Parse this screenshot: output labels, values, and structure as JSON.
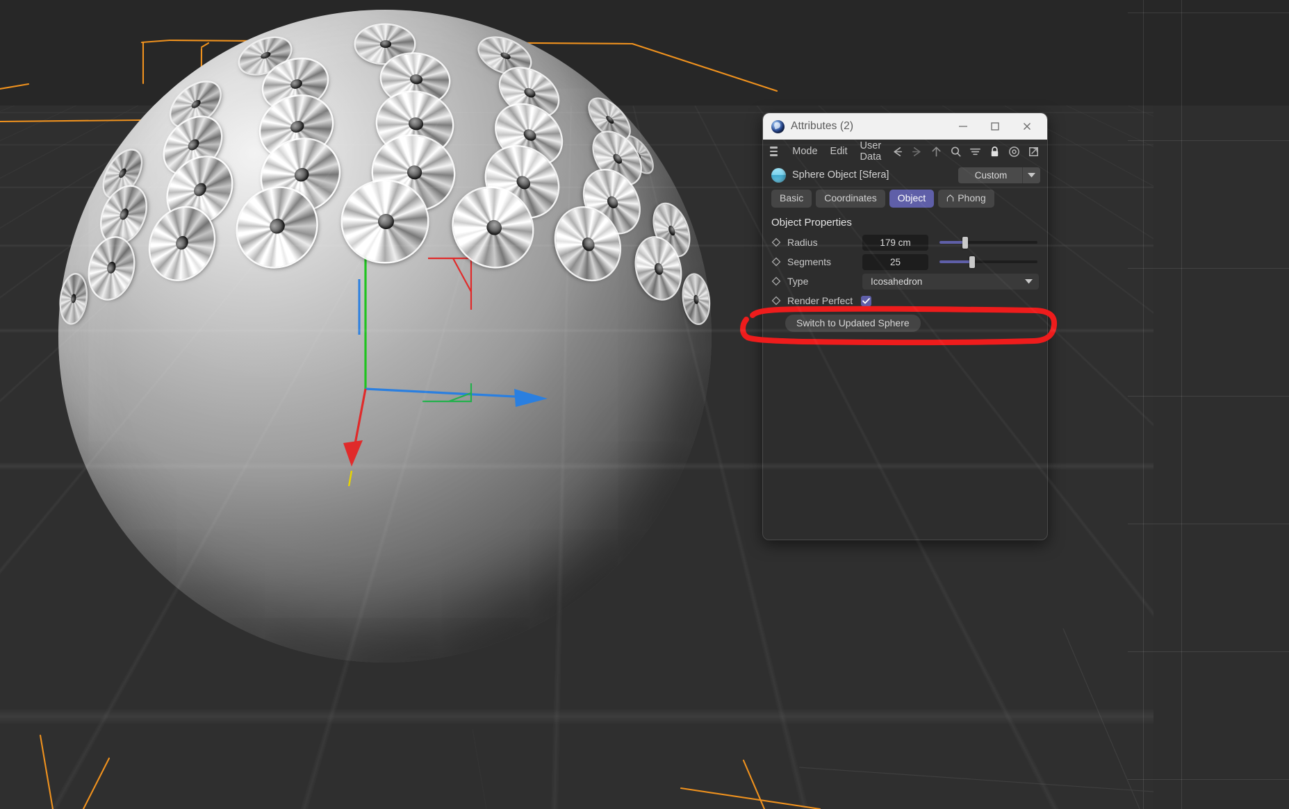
{
  "app": {
    "window_title": "Attributes (2)",
    "logo_icon": "cinema4d-logo-icon"
  },
  "titlebar_buttons": [
    {
      "name": "minimize-button",
      "icon": "minimize-icon"
    },
    {
      "name": "maximize-button",
      "icon": "maximize-icon"
    },
    {
      "name": "close-button",
      "icon": "close-icon"
    }
  ],
  "toolbar": {
    "menu_icon": "hamburger-menu-icon",
    "menus": [
      {
        "label": "Mode"
      },
      {
        "label": "Edit"
      },
      {
        "label": "User Data"
      }
    ],
    "icons": [
      {
        "name": "back-arrow-icon"
      },
      {
        "name": "forward-arrow-icon"
      },
      {
        "name": "up-arrow-icon"
      },
      {
        "name": "search-icon"
      },
      {
        "name": "filter-icon"
      },
      {
        "name": "lock-icon"
      },
      {
        "name": "target-icon"
      },
      {
        "name": "open-external-icon"
      }
    ]
  },
  "object_header": {
    "icon": "sphere-object-icon",
    "name": "Sphere Object [Sfera]",
    "preset_value": "Custom",
    "preset_arrow_icon": "chevron-down-icon"
  },
  "tabs": [
    {
      "label": "Basic",
      "active": false
    },
    {
      "label": "Coordinates",
      "active": false
    },
    {
      "label": "Object",
      "active": true
    },
    {
      "label": "Phong",
      "active": false,
      "icon": "phong-icon"
    }
  ],
  "object_properties": {
    "section_title": "Object Properties",
    "rows": [
      {
        "label": "Radius",
        "type": "number",
        "value": "179 cm",
        "slider_percent": 26
      },
      {
        "label": "Segments",
        "type": "number",
        "value": "25",
        "slider_percent": 33
      },
      {
        "label": "Type",
        "type": "dropdown",
        "value": "Icosahedron",
        "arrow_icon": "chevron-down-icon",
        "highlighted": true
      },
      {
        "label": "Render Perfect",
        "type": "checkbox",
        "checked": true
      }
    ],
    "action_button": "Switch to Updated Sphere"
  },
  "annotation": {
    "shape": "hand-drawn-rounded-rectangle",
    "color": "#ee1c1c",
    "targets_row": "Type"
  },
  "viewport": {
    "object_description": "Sphere with icosahedron segments and conical dimples",
    "gizmo_axes": [
      {
        "axis": "Y",
        "color": "#1fc41f",
        "direction": "up"
      },
      {
        "axis": "X",
        "color": "#2a7fe0",
        "direction": "right"
      },
      {
        "axis": "Z",
        "color": "#e02a2a",
        "direction": "down"
      },
      {
        "axis": "scale-handle",
        "color": "#e8d400",
        "direction": "down"
      }
    ],
    "bounding_box_color": "#f0921e",
    "grid_color": "#4a4a4a",
    "background_color": "#2e2e2e"
  },
  "colors": {
    "accent": "#5f5fa8",
    "panel_bg": "#2d2d2d",
    "titlebar_bg": "#f1f1f1",
    "annotation_red": "#ee1c1c",
    "orange_bbox": "#f0921e"
  }
}
